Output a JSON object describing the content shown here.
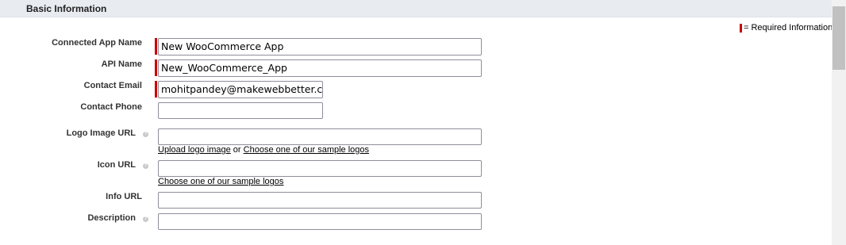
{
  "section": {
    "title": "Basic Information"
  },
  "required_legend": {
    "text": "= Required Information"
  },
  "fields": {
    "connected_app_name": {
      "label": "Connected App Name",
      "value": "New WooCommerce App"
    },
    "api_name": {
      "label": "API Name",
      "value": "New_WooCommerce_App"
    },
    "contact_email": {
      "label": "Contact Email",
      "value": "mohitpandey@makewebbetter.com"
    },
    "contact_phone": {
      "label": "Contact Phone",
      "value": ""
    },
    "logo_image_url": {
      "label": "Logo Image URL",
      "value": "",
      "link_upload": "Upload logo image",
      "link_or": "or",
      "link_samples": "Choose one of our sample logos"
    },
    "icon_url": {
      "label": "Icon URL",
      "value": "",
      "link_samples": "Choose one of our sample logos"
    },
    "info_url": {
      "label": "Info URL",
      "value": ""
    },
    "description": {
      "label": "Description",
      "value": ""
    }
  },
  "help_icon": {
    "name": "help-icon",
    "glyph": "?"
  },
  "colors": {
    "required": "#cc0000",
    "header_bg": "#e8ebf0"
  }
}
